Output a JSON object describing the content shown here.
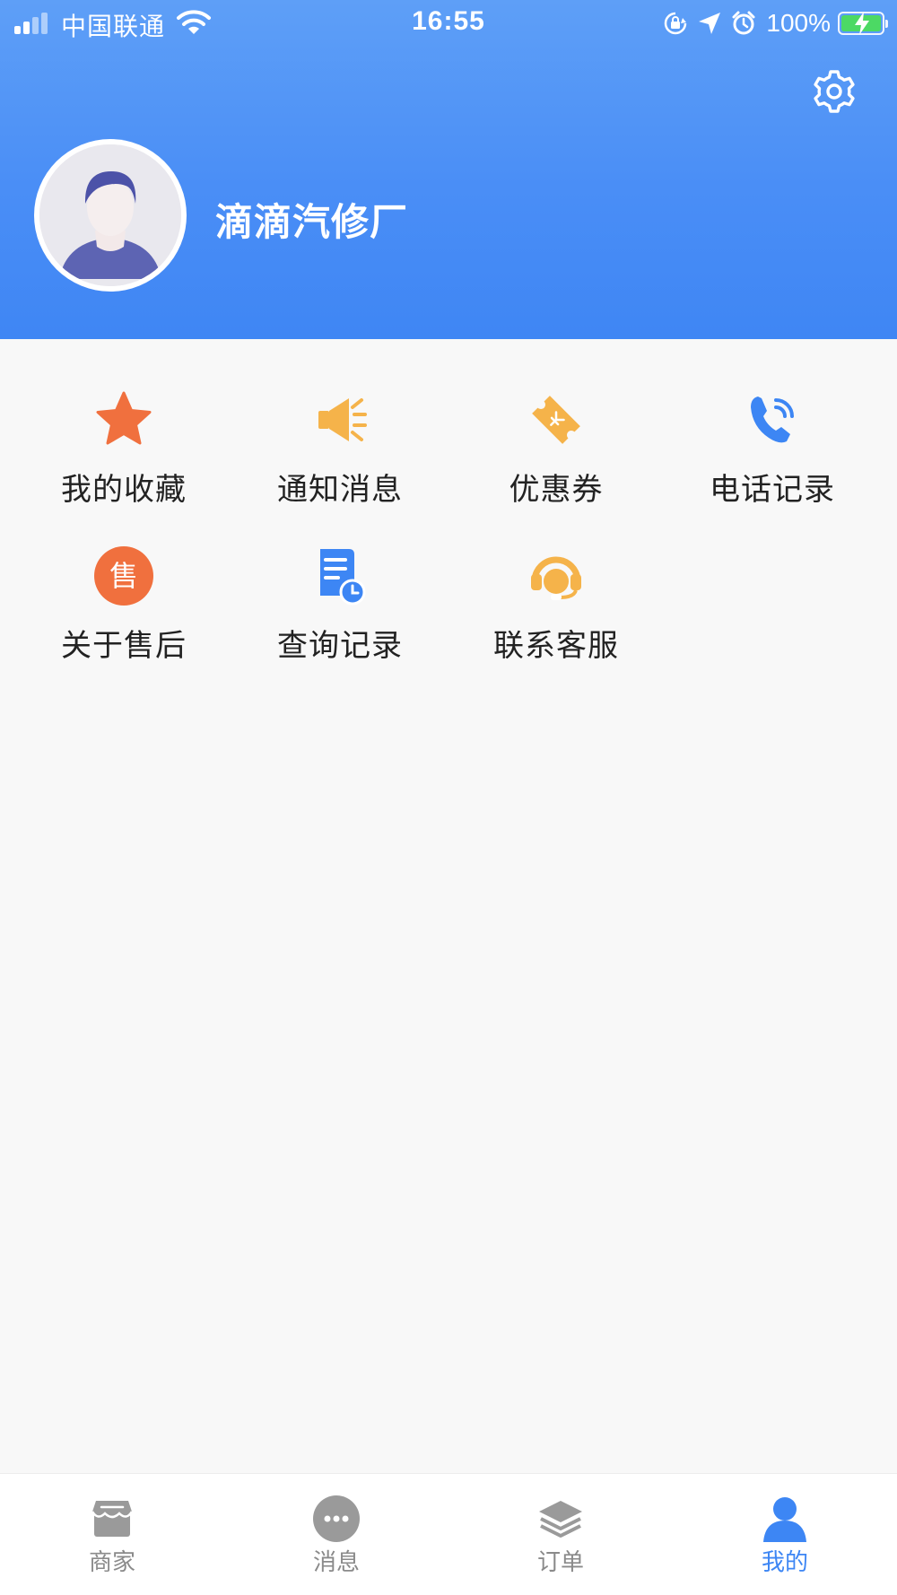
{
  "status_bar": {
    "carrier": "中国联通",
    "time": "16:55",
    "battery_percent": "100%"
  },
  "profile": {
    "store_name": "滴滴汽修厂"
  },
  "menu": {
    "items": [
      {
        "label": "我的收藏",
        "icon": "star-icon",
        "color": "#f0703e"
      },
      {
        "label": "通知消息",
        "icon": "megaphone-icon",
        "color": "#f5b34a"
      },
      {
        "label": "优惠券",
        "icon": "coupon-icon",
        "color": "#f5b34a"
      },
      {
        "label": "电话记录",
        "icon": "phone-icon",
        "color": "#3d86f4"
      },
      {
        "label": "关于售后",
        "icon": "after-sales-icon",
        "color": "#f0703e"
      },
      {
        "label": "查询记录",
        "icon": "query-record-icon",
        "color": "#3d86f4"
      },
      {
        "label": "联系客服",
        "icon": "headset-icon",
        "color": "#f5b34a"
      }
    ],
    "after_sales_glyph": "售"
  },
  "tabbar": {
    "tabs": [
      {
        "label": "商家",
        "icon": "store-icon",
        "active": false
      },
      {
        "label": "消息",
        "icon": "message-icon",
        "active": false
      },
      {
        "label": "订单",
        "icon": "layers-icon",
        "active": false
      },
      {
        "label": "我的",
        "icon": "person-icon",
        "active": true
      }
    ]
  },
  "colors": {
    "header_blue": "#4a8ef6",
    "active_tab": "#3d86f4",
    "inactive_tab": "#8a8a8a"
  }
}
